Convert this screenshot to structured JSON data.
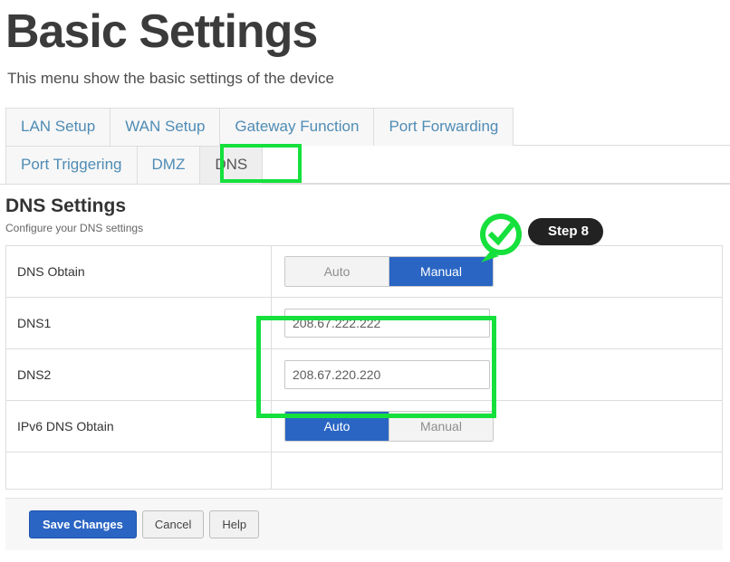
{
  "header": {
    "title": "Basic Settings",
    "subtitle": "This menu show the basic settings of the device"
  },
  "tabs": {
    "row1": [
      {
        "label": "LAN Setup",
        "active": false
      },
      {
        "label": "WAN Setup",
        "active": false
      },
      {
        "label": "Gateway Function",
        "active": false
      },
      {
        "label": "Port Forwarding",
        "active": false
      }
    ],
    "row2": [
      {
        "label": "Port Triggering",
        "active": false
      },
      {
        "label": "DMZ",
        "active": false
      },
      {
        "label": "DNS",
        "active": true
      }
    ]
  },
  "section": {
    "heading": "DNS Settings",
    "description": "Configure your DNS settings"
  },
  "callout": {
    "label": "Step 8",
    "icon": "check-circle-icon",
    "color": "#15e03c"
  },
  "settings": {
    "rows": [
      {
        "label": "DNS Obtain",
        "type": "toggle",
        "options": [
          "Auto",
          "Manual"
        ],
        "selected": "Manual"
      },
      {
        "label": "DNS1",
        "type": "text",
        "value": "208.67.222.222",
        "placeholder": ""
      },
      {
        "label": "DNS2",
        "type": "text",
        "value": "208.67.220.220",
        "placeholder": ""
      },
      {
        "label": "IPv6 DNS Obtain",
        "type": "toggle",
        "options": [
          "Auto",
          "Manual"
        ],
        "selected": "Auto"
      }
    ]
  },
  "footer": {
    "save_label": "Save Changes",
    "cancel_label": "Cancel",
    "help_label": "Help"
  },
  "highlight_color": "#15e03c"
}
